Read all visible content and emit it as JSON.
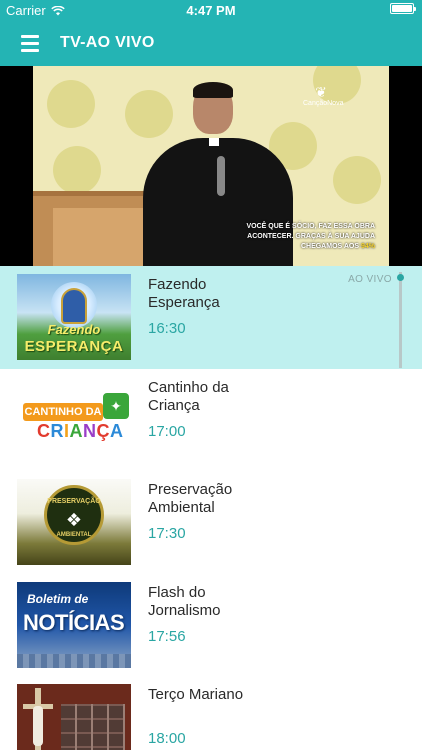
{
  "status_bar": {
    "carrier": "Carrier",
    "time": "4:47 PM"
  },
  "nav": {
    "title": "TV-AO VIVO",
    "menu_icon": "hamburger-menu-icon"
  },
  "video": {
    "channel_logo_text": "CançãoNova",
    "caption_line1": "VOCÊ QUE É SÓCIO, FAZ ESSA OBRA",
    "caption_line2": "ACONTECER. GRAÇAS À SUA AJUDA",
    "caption_line3_prefix": "CHEGAMOS AOS ",
    "caption_percent": "94%"
  },
  "live_label": "AO VIVO",
  "programs": [
    {
      "title": "Fazendo Esperança",
      "time": "16:30",
      "thumb_text_1": "Fazendo",
      "thumb_text_2": "ESPERANÇA"
    },
    {
      "title": "Cantinho da Criança",
      "time": "17:00",
      "thumb_text_1": "CANTINHO DA",
      "thumb_text_2": "CRIANÇA"
    },
    {
      "title": "Preservação Ambiental",
      "time": "17:30",
      "thumb_text_1": "PRESERVAÇÃO",
      "thumb_text_2": "AMBIENTAL"
    },
    {
      "title": "Flash do Jornalismo",
      "time": "17:56",
      "thumb_text_1": "Boletim de",
      "thumb_text_2": "NOTÍCIAS"
    },
    {
      "title": "Terço Mariano",
      "time": "18:00"
    }
  ],
  "colors": {
    "accent": "#24b4b4",
    "live_row": "#bff0ef",
    "time_text": "#2aa6a3"
  }
}
